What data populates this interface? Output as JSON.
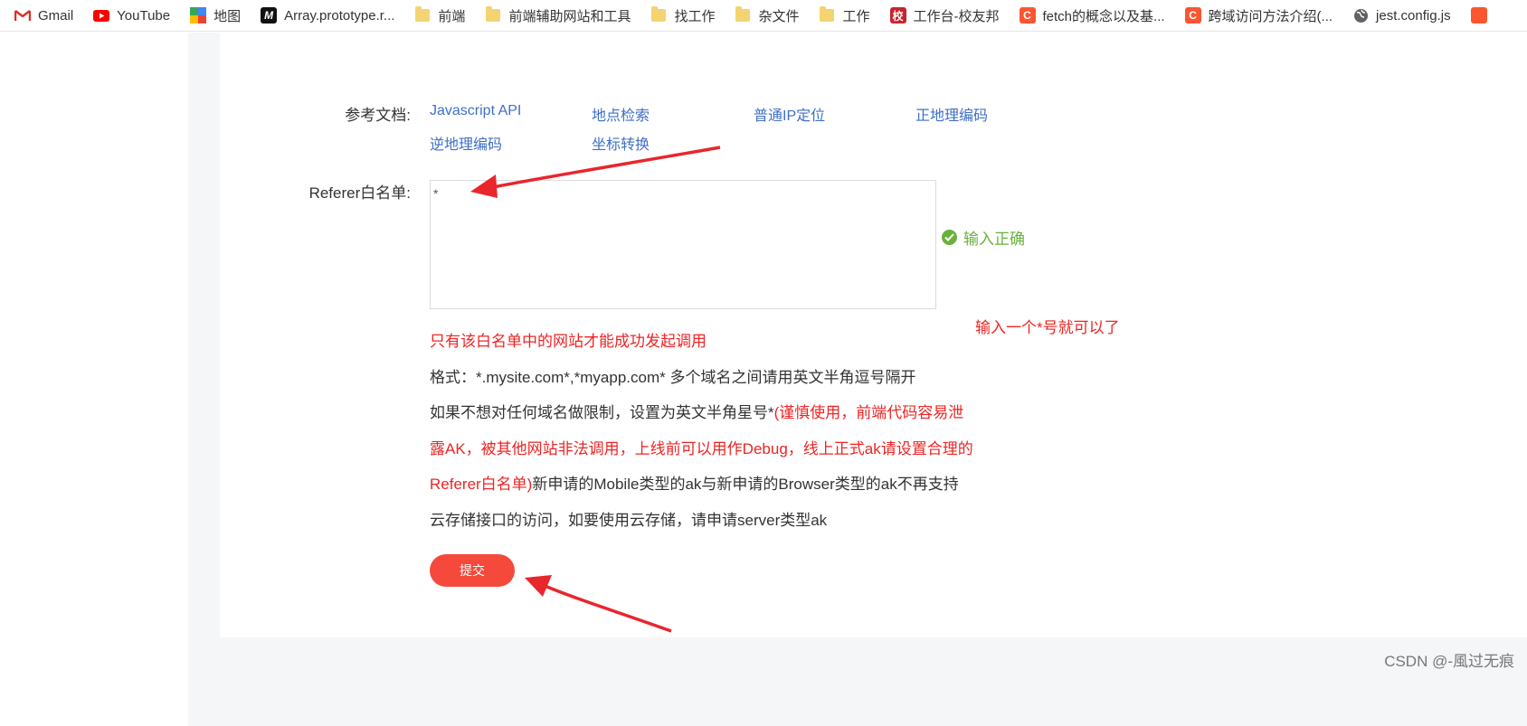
{
  "bookmarks": [
    {
      "label": "Gmail",
      "icon": "gmail-icon"
    },
    {
      "label": "YouTube",
      "icon": "youtube-icon"
    },
    {
      "label": "地图",
      "icon": "maps-icon"
    },
    {
      "label": "Array.prototype.r...",
      "icon": "mdn-icon"
    },
    {
      "label": "前端",
      "icon": "folder-icon"
    },
    {
      "label": "前端辅助网站和工具",
      "icon": "folder-icon"
    },
    {
      "label": "找工作",
      "icon": "folder-icon"
    },
    {
      "label": "杂文件",
      "icon": "folder-icon"
    },
    {
      "label": "工作",
      "icon": "folder-icon"
    },
    {
      "label": "工作台-校友邦",
      "icon": "xiaoyoubang-icon",
      "glyph": "校"
    },
    {
      "label": "fetch的概念以及基...",
      "icon": "csdn-icon",
      "glyph": "C"
    },
    {
      "label": "跨域访问方法介绍(...",
      "icon": "csdn-icon",
      "glyph": "C"
    },
    {
      "label": "jest.config.js",
      "icon": "globe-icon"
    }
  ],
  "colors": {
    "link": "#3f6fc6",
    "warning_red": "#ee2424",
    "success_green": "#69b13b",
    "submit_bg": "#f4493b",
    "annotation_arrow": "#e8262c"
  },
  "form": {
    "docs_label": "参考文档:",
    "doc_links": [
      "Javascript API",
      "地点检索",
      "普通IP定位",
      "正地理编码",
      "逆地理编码",
      "坐标转换"
    ],
    "referer_label": "Referer白名单:",
    "referer_value": "*",
    "validation_text": "输入正确",
    "hint_line1": "只有该白名单中的网站才能成功发起调用",
    "hint_line2": "格式：*.mysite.com*,*myapp.com* 多个域名之间请用英文半角逗号隔开",
    "hint_line3_dark": "如果不想对任何域名做限制，设置为英文半角星号*",
    "hint_line3_red": "(谨慎使用，前端代码容易泄",
    "hint_line4_red": "露AK，被其他网站非法调用，上线前可以用作Debug，线上正式ak请设置合理的",
    "hint_line5_red": "Referer白名单)",
    "hint_line5_dark": "新申请的Mobile类型的ak与新申请的Browser类型的ak不再支持",
    "hint_line6": "云存储接口的访问，如要使用云存储，请申请server类型ak",
    "submit_label": "提交"
  },
  "annotation": {
    "text": "输入一个*号就可以了"
  },
  "watermark": "CSDN @-風过无痕"
}
